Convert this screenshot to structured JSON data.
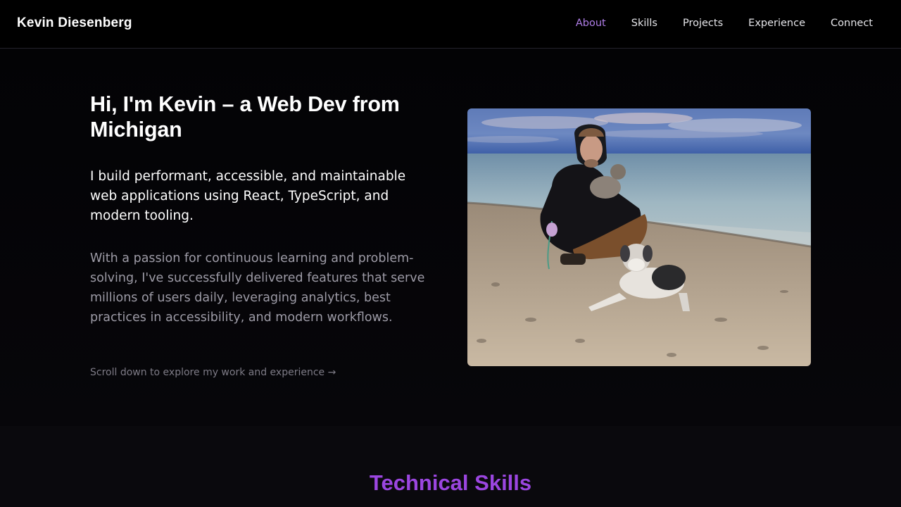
{
  "header": {
    "brand": "Kevin Diesenberg",
    "nav": [
      {
        "label": "About",
        "active": true
      },
      {
        "label": "Skills",
        "active": false
      },
      {
        "label": "Projects",
        "active": false
      },
      {
        "label": "Experience",
        "active": false
      },
      {
        "label": "Connect",
        "active": false
      }
    ]
  },
  "hero": {
    "title": "Hi, I'm Kevin – a Web Dev from Michigan",
    "lead": "I build performant, accessible, and maintainable web applications using React, TypeScript, and modern tooling.",
    "body": "With a passion for continuous learning and problem-solving, I've successfully delivered features that serve millions of users daily, leveraging analytics, best practices in accessibility, and modern workflows.",
    "cta": "Scroll down to explore my work and experience →"
  },
  "skills": {
    "title": "Technical Skills"
  },
  "colors": {
    "accent": "#9b46e0",
    "active_nav": "#b07ee8",
    "background": "#070609",
    "muted_text": "#9d9ba6"
  }
}
